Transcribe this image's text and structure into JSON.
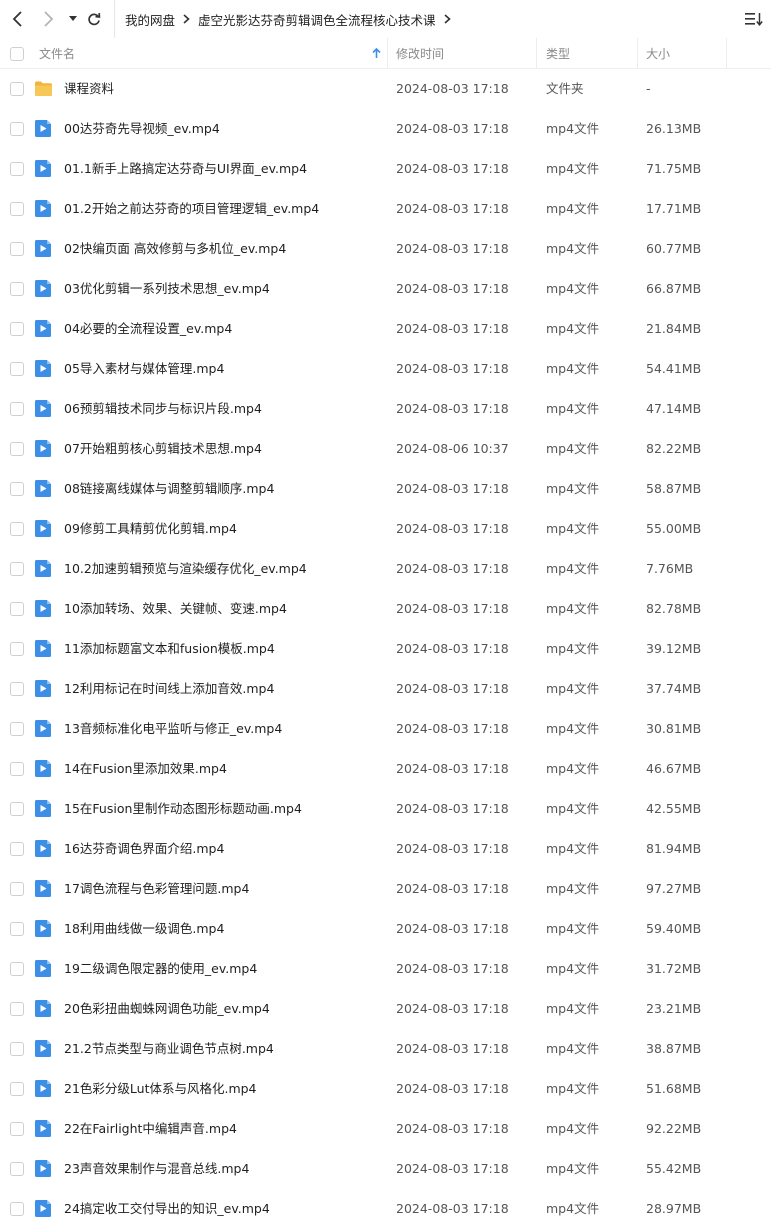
{
  "toolbar": {
    "back_icon": "chevron-left-icon",
    "forward_icon": "chevron-right-icon",
    "history_icon": "caret-down-icon",
    "refresh_icon": "refresh-icon",
    "breadcrumbs": [
      "我的网盘",
      "虚空光影达芬奇剪辑调色全流程核心技术课"
    ],
    "list_mode_icon": "sort-list-icon"
  },
  "columns": {
    "name": "文件名",
    "modified": "修改时间",
    "type": "类型",
    "size": "大小",
    "sort_icon": "sort-up-arrow-icon"
  },
  "colors": {
    "accent": "#3a8eea",
    "folder": "#f7c04a",
    "video": "#3d8fe6"
  },
  "files": [
    {
      "icon": "folder-icon",
      "name": "课程资料",
      "modified": "2024-08-03 17:18",
      "type": "文件夹",
      "size": "-"
    },
    {
      "icon": "video-file-icon",
      "name": "00达芬奇先导视频_ev.mp4",
      "modified": "2024-08-03 17:18",
      "type": "mp4文件",
      "size": "26.13MB"
    },
    {
      "icon": "video-file-icon",
      "name": "01.1新手上路搞定达芬奇与UI界面_ev.mp4",
      "modified": "2024-08-03 17:18",
      "type": "mp4文件",
      "size": "71.75MB"
    },
    {
      "icon": "video-file-icon",
      "name": "01.2开始之前达芬奇的项目管理逻辑_ev.mp4",
      "modified": "2024-08-03 17:18",
      "type": "mp4文件",
      "size": "17.71MB"
    },
    {
      "icon": "video-file-icon",
      "name": "02快编页面 高效修剪与多机位_ev.mp4",
      "modified": "2024-08-03 17:18",
      "type": "mp4文件",
      "size": "60.77MB"
    },
    {
      "icon": "video-file-icon",
      "name": "03优化剪辑一系列技术思想_ev.mp4",
      "modified": "2024-08-03 17:18",
      "type": "mp4文件",
      "size": "66.87MB"
    },
    {
      "icon": "video-file-icon",
      "name": "04必要的全流程设置_ev.mp4",
      "modified": "2024-08-03 17:18",
      "type": "mp4文件",
      "size": "21.84MB"
    },
    {
      "icon": "video-file-icon",
      "name": "05导入素材与媒体管理.mp4",
      "modified": "2024-08-03 17:18",
      "type": "mp4文件",
      "size": "54.41MB"
    },
    {
      "icon": "video-file-icon",
      "name": "06预剪辑技术同步与标识片段.mp4",
      "modified": "2024-08-03 17:18",
      "type": "mp4文件",
      "size": "47.14MB"
    },
    {
      "icon": "video-file-icon",
      "name": "07开始粗剪核心剪辑技术思想.mp4",
      "modified": "2024-08-06 10:37",
      "type": "mp4文件",
      "size": "82.22MB"
    },
    {
      "icon": "video-file-icon",
      "name": "08链接离线媒体与调整剪辑顺序.mp4",
      "modified": "2024-08-03 17:18",
      "type": "mp4文件",
      "size": "58.87MB"
    },
    {
      "icon": "video-file-icon",
      "name": "09修剪工具精剪优化剪辑.mp4",
      "modified": "2024-08-03 17:18",
      "type": "mp4文件",
      "size": "55.00MB"
    },
    {
      "icon": "video-file-icon",
      "name": "10.2加速剪辑预览与渲染缓存优化_ev.mp4",
      "modified": "2024-08-03 17:18",
      "type": "mp4文件",
      "size": "7.76MB"
    },
    {
      "icon": "video-file-icon",
      "name": "10添加转场、效果、关键帧、变速.mp4",
      "modified": "2024-08-03 17:18",
      "type": "mp4文件",
      "size": "82.78MB"
    },
    {
      "icon": "video-file-icon",
      "name": "11添加标题富文本和fusion模板.mp4",
      "modified": "2024-08-03 17:18",
      "type": "mp4文件",
      "size": "39.12MB"
    },
    {
      "icon": "video-file-icon",
      "name": "12利用标记在时间线上添加音效.mp4",
      "modified": "2024-08-03 17:18",
      "type": "mp4文件",
      "size": "37.74MB"
    },
    {
      "icon": "video-file-icon",
      "name": "13音频标准化电平监听与修正_ev.mp4",
      "modified": "2024-08-03 17:18",
      "type": "mp4文件",
      "size": "30.81MB"
    },
    {
      "icon": "video-file-icon",
      "name": "14在Fusion里添加效果.mp4",
      "modified": "2024-08-03 17:18",
      "type": "mp4文件",
      "size": "46.67MB"
    },
    {
      "icon": "video-file-icon",
      "name": "15在Fusion里制作动态图形标题动画.mp4",
      "modified": "2024-08-03 17:18",
      "type": "mp4文件",
      "size": "42.55MB"
    },
    {
      "icon": "video-file-icon",
      "name": "16达芬奇调色界面介绍.mp4",
      "modified": "2024-08-03 17:18",
      "type": "mp4文件",
      "size": "81.94MB"
    },
    {
      "icon": "video-file-icon",
      "name": "17调色流程与色彩管理问题.mp4",
      "modified": "2024-08-03 17:18",
      "type": "mp4文件",
      "size": "97.27MB"
    },
    {
      "icon": "video-file-icon",
      "name": "18利用曲线做一级调色.mp4",
      "modified": "2024-08-03 17:18",
      "type": "mp4文件",
      "size": "59.40MB"
    },
    {
      "icon": "video-file-icon",
      "name": "19二级调色限定器的使用_ev.mp4",
      "modified": "2024-08-03 17:18",
      "type": "mp4文件",
      "size": "31.72MB"
    },
    {
      "icon": "video-file-icon",
      "name": "20色彩扭曲蜘蛛网调色功能_ev.mp4",
      "modified": "2024-08-03 17:18",
      "type": "mp4文件",
      "size": "23.21MB"
    },
    {
      "icon": "video-file-icon",
      "name": "21.2节点类型与商业调色节点树.mp4",
      "modified": "2024-08-03 17:18",
      "type": "mp4文件",
      "size": "38.87MB"
    },
    {
      "icon": "video-file-icon",
      "name": "21色彩分级Lut体系与风格化.mp4",
      "modified": "2024-08-03 17:18",
      "type": "mp4文件",
      "size": "51.68MB"
    },
    {
      "icon": "video-file-icon",
      "name": "22在Fairlight中编辑声音.mp4",
      "modified": "2024-08-03 17:18",
      "type": "mp4文件",
      "size": "92.22MB"
    },
    {
      "icon": "video-file-icon",
      "name": "23声音效果制作与混音总线.mp4",
      "modified": "2024-08-03 17:18",
      "type": "mp4文件",
      "size": "55.42MB"
    },
    {
      "icon": "video-file-icon",
      "name": "24搞定收工交付导出的知识_ev.mp4",
      "modified": "2024-08-03 17:18",
      "type": "mp4文件",
      "size": "28.97MB"
    }
  ]
}
